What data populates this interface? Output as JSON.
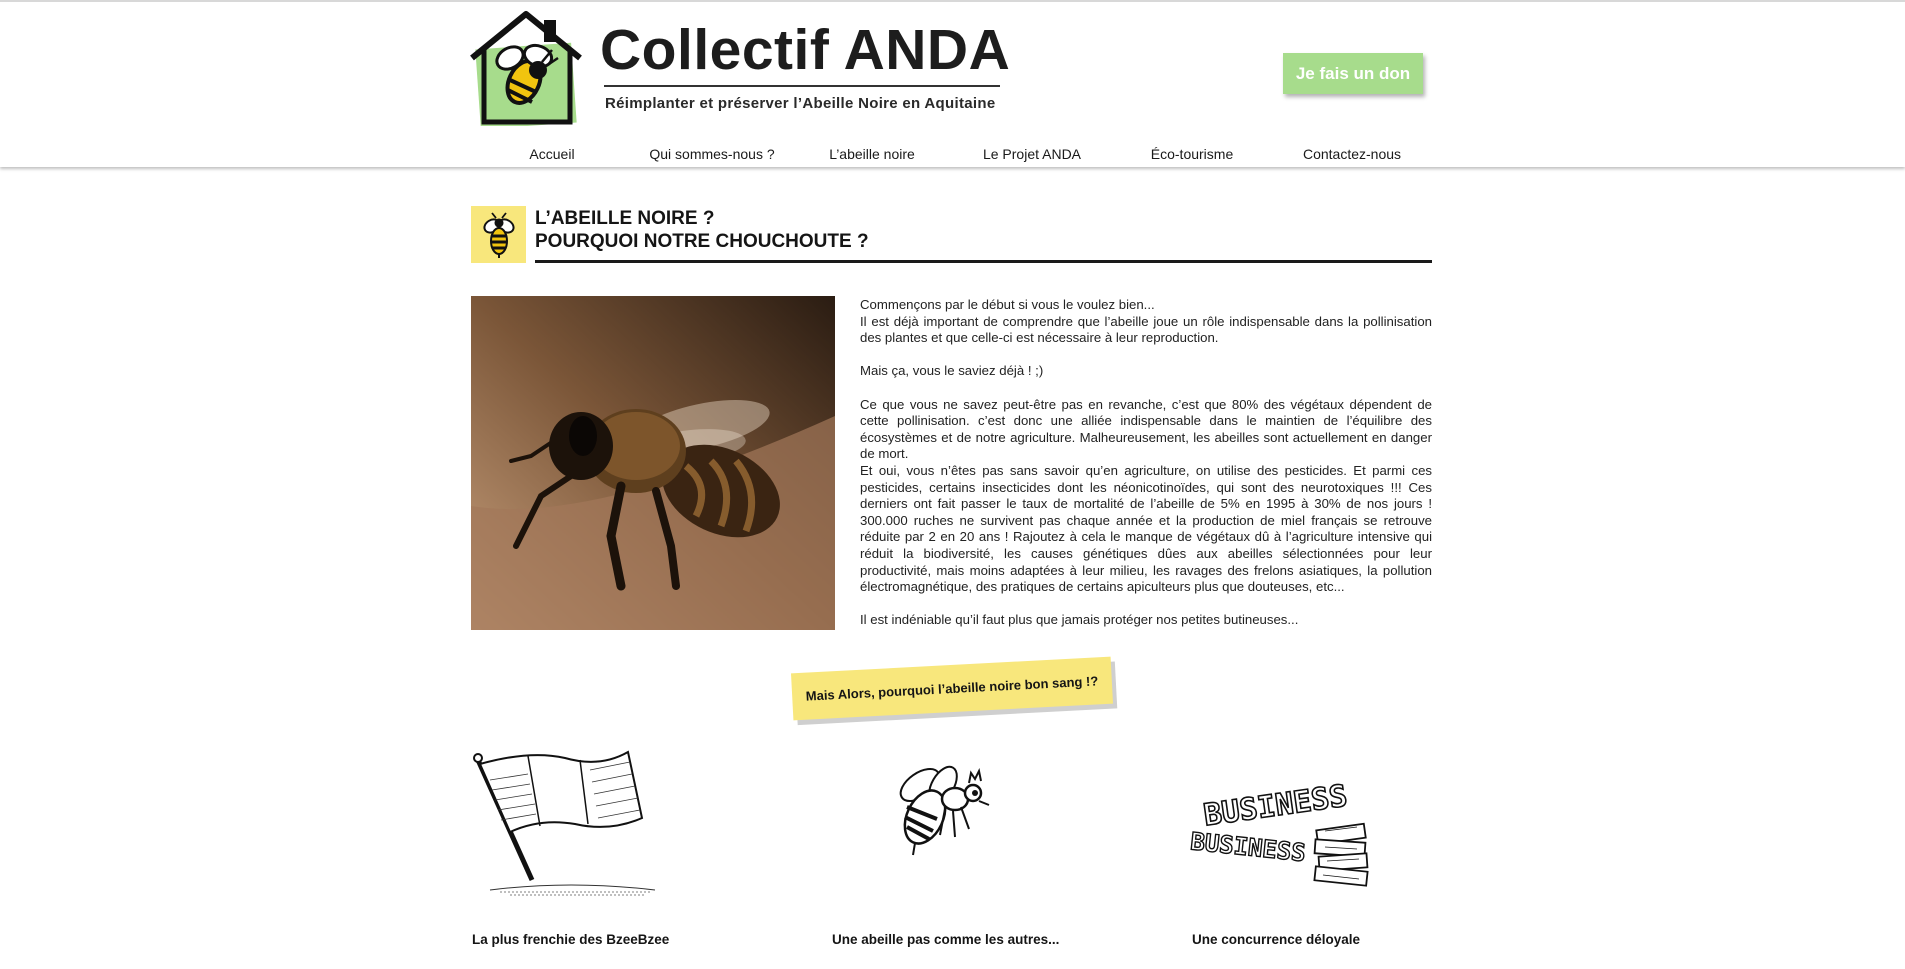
{
  "header": {
    "title": "Collectif ANDA",
    "tagline": "Réimplanter et préserver l’Abeille Noire en Aquitaine",
    "donate_label": "Je fais un don",
    "nav": [
      "Accueil",
      "Qui sommes-nous ?",
      "L’abeille noire",
      "Le Projet ANDA",
      "Éco-tourisme",
      "Contactez-nous"
    ]
  },
  "section": {
    "title_line1": "L’ABEILLE NOIRE ?",
    "title_line2": "POURQUOI NOTRE CHOUCHOUTE ?",
    "paragraphs": [
      "Commençons par le début si vous le voulez bien...",
      "Il est déjà important de comprendre que l’abeille joue un rôle indispensable dans la pollinisation des plantes et que celle-ci est nécessaire à leur reproduction.",
      "",
      "Mais ça, vous le saviez déjà ! ;)",
      "",
      "Ce que vous ne savez peut-être pas en revanche, c’est que 80% des végétaux dépendent de cette pollinisation. c’est donc une alliée indispensable dans le maintien de l’équilibre des écosystèmes et de notre agriculture. Malheureusement, les abeilles sont actuellement en danger de mort.",
      "Et oui, vous n’êtes pas sans savoir qu’en agriculture, on utilise des pesticides. Et parmi ces pesticides, certains insecticides dont les néonicotinoïdes, qui sont des neurotoxiques !!! Ces derniers ont fait passer le taux de mortalité de l’abeille de 5% en 1995 à 30% de nos jours ! 300.000 ruches ne survivent pas chaque année et la production de miel français se retrouve réduite par 2 en 20 ans ! Rajoutez à cela le manque de végétaux dû à l’agriculture intensive qui réduit la biodiversité, les causes génétiques dûes aux abeilles sélectionnées pour leur productivité, mais moins adaptées à leur milieu, les ravages des frelons asiatiques, la pollution électromagnétique, des pratiques de certains apiculteurs plus que douteuses, etc...",
      "",
      "Il est indéniable qu’il faut plus que jamais protéger nos petites butineuses..."
    ]
  },
  "banner_text": "Mais Alors, pourquoi l’abeille noire bon sang !?",
  "illustrations": {
    "business_word": "BUSINESS"
  },
  "features": [
    "La plus frenchie des BzeeBzee",
    "Une abeille pas comme les autres...",
    "Une concurrence déloyale"
  ],
  "colors": {
    "accent_green": "#a7dc8c",
    "accent_yellow": "#f8e77c",
    "text_dark": "#1a1a1a"
  }
}
